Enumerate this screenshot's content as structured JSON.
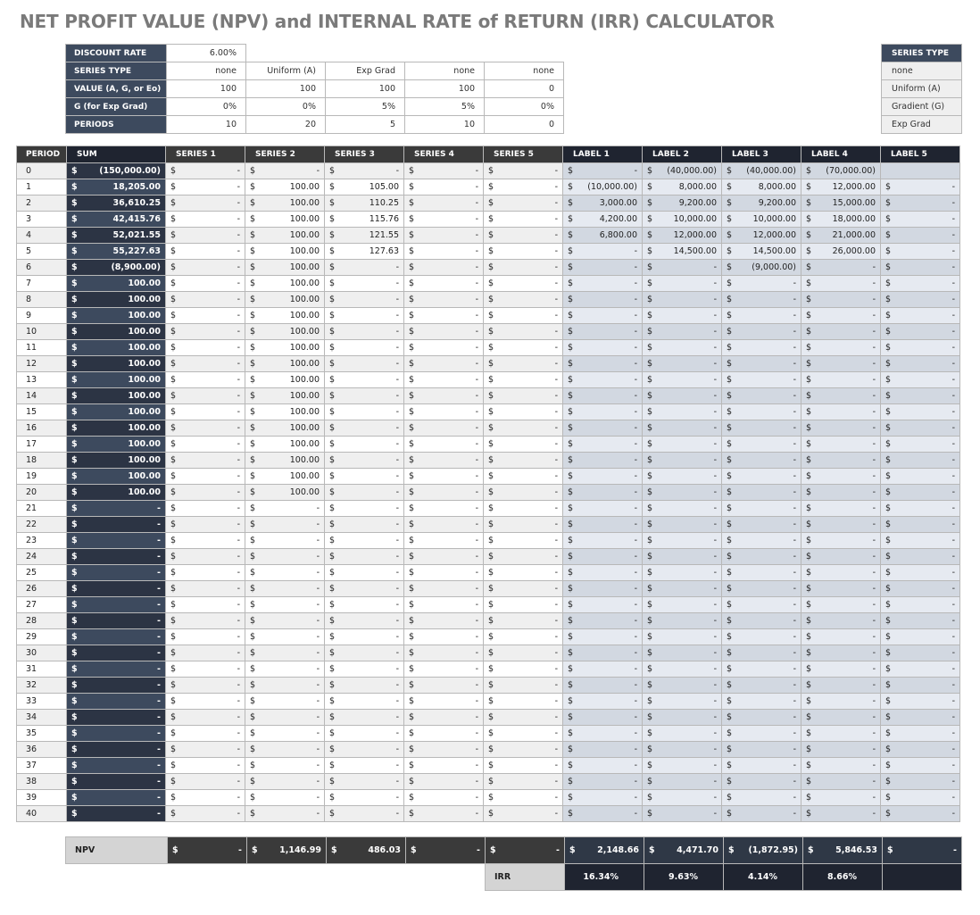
{
  "title": "NET PROFIT VALUE (NPV) and INTERNAL RATE of RETURN (IRR) CALCULATOR",
  "settings": {
    "discount_rate_label": "DISCOUNT RATE",
    "discount_rate": "6.00%",
    "rows": [
      {
        "label": "SERIES TYPE",
        "values": [
          "none",
          "Uniform (A)",
          "Exp Grad",
          "none",
          "none"
        ]
      },
      {
        "label": "VALUE (A, G, or Eo)",
        "values": [
          "100",
          "100",
          "100",
          "100",
          "0"
        ]
      },
      {
        "label": "G (for Exp Grad)",
        "values": [
          "0%",
          "0%",
          "5%",
          "5%",
          "0%"
        ]
      },
      {
        "label": "PERIODS",
        "values": [
          "10",
          "20",
          "5",
          "10",
          "0"
        ]
      }
    ]
  },
  "legend": {
    "header": "SERIES TYPE",
    "items": [
      "none",
      "Uniform (A)",
      "Gradient (G)",
      "Exp Grad"
    ]
  },
  "main": {
    "headers": [
      "PERIOD",
      "SUM",
      "SERIES 1",
      "SERIES 2",
      "SERIES 3",
      "SERIES 4",
      "SERIES 5",
      "LABEL 1",
      "LABEL 2",
      "LABEL 3",
      "LABEL 4",
      "LABEL 5"
    ],
    "currency": "$",
    "rows": [
      {
        "period": "0",
        "sum": "(150,000.00)",
        "series": [
          "-",
          "-",
          "-",
          "-",
          "-"
        ],
        "labels": [
          "-",
          "(40,000.00)",
          "(40,000.00)",
          "(70,000.00)",
          null
        ]
      },
      {
        "period": "1",
        "sum": "18,205.00",
        "series": [
          "-",
          "100.00",
          "105.00",
          "-",
          "-"
        ],
        "labels": [
          "(10,000.00)",
          "8,000.00",
          "8,000.00",
          "12,000.00",
          "-"
        ]
      },
      {
        "period": "2",
        "sum": "36,610.25",
        "series": [
          "-",
          "100.00",
          "110.25",
          "-",
          "-"
        ],
        "labels": [
          "3,000.00",
          "9,200.00",
          "9,200.00",
          "15,000.00",
          "-"
        ]
      },
      {
        "period": "3",
        "sum": "42,415.76",
        "series": [
          "-",
          "100.00",
          "115.76",
          "-",
          "-"
        ],
        "labels": [
          "4,200.00",
          "10,000.00",
          "10,000.00",
          "18,000.00",
          "-"
        ]
      },
      {
        "period": "4",
        "sum": "52,021.55",
        "series": [
          "-",
          "100.00",
          "121.55",
          "-",
          "-"
        ],
        "labels": [
          "6,800.00",
          "12,000.00",
          "12,000.00",
          "21,000.00",
          "-"
        ]
      },
      {
        "period": "5",
        "sum": "55,227.63",
        "series": [
          "-",
          "100.00",
          "127.63",
          "-",
          "-"
        ],
        "labels": [
          "-",
          "14,500.00",
          "14,500.00",
          "26,000.00",
          "-"
        ]
      },
      {
        "period": "6",
        "sum": "(8,900.00)",
        "series": [
          "-",
          "100.00",
          "-",
          "-",
          "-"
        ],
        "labels": [
          "-",
          "-",
          "(9,000.00)",
          "-",
          "-"
        ]
      },
      {
        "period": "7",
        "sum": "100.00",
        "series": [
          "-",
          "100.00",
          "-",
          "-",
          "-"
        ],
        "labels": [
          "-",
          "-",
          "-",
          "-",
          "-"
        ]
      },
      {
        "period": "8",
        "sum": "100.00",
        "series": [
          "-",
          "100.00",
          "-",
          "-",
          "-"
        ],
        "labels": [
          "-",
          "-",
          "-",
          "-",
          "-"
        ]
      },
      {
        "period": "9",
        "sum": "100.00",
        "series": [
          "-",
          "100.00",
          "-",
          "-",
          "-"
        ],
        "labels": [
          "-",
          "-",
          "-",
          "-",
          "-"
        ]
      },
      {
        "period": "10",
        "sum": "100.00",
        "series": [
          "-",
          "100.00",
          "-",
          "-",
          "-"
        ],
        "labels": [
          "-",
          "-",
          "-",
          "-",
          "-"
        ]
      },
      {
        "period": "11",
        "sum": "100.00",
        "series": [
          "-",
          "100.00",
          "-",
          "-",
          "-"
        ],
        "labels": [
          "-",
          "-",
          "-",
          "-",
          "-"
        ]
      },
      {
        "period": "12",
        "sum": "100.00",
        "series": [
          "-",
          "100.00",
          "-",
          "-",
          "-"
        ],
        "labels": [
          "-",
          "-",
          "-",
          "-",
          "-"
        ]
      },
      {
        "period": "13",
        "sum": "100.00",
        "series": [
          "-",
          "100.00",
          "-",
          "-",
          "-"
        ],
        "labels": [
          "-",
          "-",
          "-",
          "-",
          "-"
        ]
      },
      {
        "period": "14",
        "sum": "100.00",
        "series": [
          "-",
          "100.00",
          "-",
          "-",
          "-"
        ],
        "labels": [
          "-",
          "-",
          "-",
          "-",
          "-"
        ]
      },
      {
        "period": "15",
        "sum": "100.00",
        "series": [
          "-",
          "100.00",
          "-",
          "-",
          "-"
        ],
        "labels": [
          "-",
          "-",
          "-",
          "-",
          "-"
        ]
      },
      {
        "period": "16",
        "sum": "100.00",
        "series": [
          "-",
          "100.00",
          "-",
          "-",
          "-"
        ],
        "labels": [
          "-",
          "-",
          "-",
          "-",
          "-"
        ]
      },
      {
        "period": "17",
        "sum": "100.00",
        "series": [
          "-",
          "100.00",
          "-",
          "-",
          "-"
        ],
        "labels": [
          "-",
          "-",
          "-",
          "-",
          "-"
        ]
      },
      {
        "period": "18",
        "sum": "100.00",
        "series": [
          "-",
          "100.00",
          "-",
          "-",
          "-"
        ],
        "labels": [
          "-",
          "-",
          "-",
          "-",
          "-"
        ]
      },
      {
        "period": "19",
        "sum": "100.00",
        "series": [
          "-",
          "100.00",
          "-",
          "-",
          "-"
        ],
        "labels": [
          "-",
          "-",
          "-",
          "-",
          "-"
        ]
      },
      {
        "period": "20",
        "sum": "100.00",
        "series": [
          "-",
          "100.00",
          "-",
          "-",
          "-"
        ],
        "labels": [
          "-",
          "-",
          "-",
          "-",
          "-"
        ]
      },
      {
        "period": "21",
        "sum": "-",
        "series": [
          "-",
          "-",
          "-",
          "-",
          "-"
        ],
        "labels": [
          "-",
          "-",
          "-",
          "-",
          "-"
        ]
      },
      {
        "period": "22",
        "sum": "-",
        "series": [
          "-",
          "-",
          "-",
          "-",
          "-"
        ],
        "labels": [
          "-",
          "-",
          "-",
          "-",
          "-"
        ]
      },
      {
        "period": "23",
        "sum": "-",
        "series": [
          "-",
          "-",
          "-",
          "-",
          "-"
        ],
        "labels": [
          "-",
          "-",
          "-",
          "-",
          "-"
        ]
      },
      {
        "period": "24",
        "sum": "-",
        "series": [
          "-",
          "-",
          "-",
          "-",
          "-"
        ],
        "labels": [
          "-",
          "-",
          "-",
          "-",
          "-"
        ]
      },
      {
        "period": "25",
        "sum": "-",
        "series": [
          "-",
          "-",
          "-",
          "-",
          "-"
        ],
        "labels": [
          "-",
          "-",
          "-",
          "-",
          "-"
        ]
      },
      {
        "period": "26",
        "sum": "-",
        "series": [
          "-",
          "-",
          "-",
          "-",
          "-"
        ],
        "labels": [
          "-",
          "-",
          "-",
          "-",
          "-"
        ]
      },
      {
        "period": "27",
        "sum": "-",
        "series": [
          "-",
          "-",
          "-",
          "-",
          "-"
        ],
        "labels": [
          "-",
          "-",
          "-",
          "-",
          "-"
        ]
      },
      {
        "period": "28",
        "sum": "-",
        "series": [
          "-",
          "-",
          "-",
          "-",
          "-"
        ],
        "labels": [
          "-",
          "-",
          "-",
          "-",
          "-"
        ]
      },
      {
        "period": "29",
        "sum": "-",
        "series": [
          "-",
          "-",
          "-",
          "-",
          "-"
        ],
        "labels": [
          "-",
          "-",
          "-",
          "-",
          "-"
        ]
      },
      {
        "period": "30",
        "sum": "-",
        "series": [
          "-",
          "-",
          "-",
          "-",
          "-"
        ],
        "labels": [
          "-",
          "-",
          "-",
          "-",
          "-"
        ]
      },
      {
        "period": "31",
        "sum": "-",
        "series": [
          "-",
          "-",
          "-",
          "-",
          "-"
        ],
        "labels": [
          "-",
          "-",
          "-",
          "-",
          "-"
        ]
      },
      {
        "period": "32",
        "sum": "-",
        "series": [
          "-",
          "-",
          "-",
          "-",
          "-"
        ],
        "labels": [
          "-",
          "-",
          "-",
          "-",
          "-"
        ]
      },
      {
        "period": "33",
        "sum": "-",
        "series": [
          "-",
          "-",
          "-",
          "-",
          "-"
        ],
        "labels": [
          "-",
          "-",
          "-",
          "-",
          "-"
        ]
      },
      {
        "period": "34",
        "sum": "-",
        "series": [
          "-",
          "-",
          "-",
          "-",
          "-"
        ],
        "labels": [
          "-",
          "-",
          "-",
          "-",
          "-"
        ]
      },
      {
        "period": "35",
        "sum": "-",
        "series": [
          "-",
          "-",
          "-",
          "-",
          "-"
        ],
        "labels": [
          "-",
          "-",
          "-",
          "-",
          "-"
        ]
      },
      {
        "period": "36",
        "sum": "-",
        "series": [
          "-",
          "-",
          "-",
          "-",
          "-"
        ],
        "labels": [
          "-",
          "-",
          "-",
          "-",
          "-"
        ]
      },
      {
        "period": "37",
        "sum": "-",
        "series": [
          "-",
          "-",
          "-",
          "-",
          "-"
        ],
        "labels": [
          "-",
          "-",
          "-",
          "-",
          "-"
        ]
      },
      {
        "period": "38",
        "sum": "-",
        "series": [
          "-",
          "-",
          "-",
          "-",
          "-"
        ],
        "labels": [
          "-",
          "-",
          "-",
          "-",
          "-"
        ]
      },
      {
        "period": "39",
        "sum": "-",
        "series": [
          "-",
          "-",
          "-",
          "-",
          "-"
        ],
        "labels": [
          "-",
          "-",
          "-",
          "-",
          "-"
        ]
      },
      {
        "period": "40",
        "sum": "-",
        "series": [
          "-",
          "-",
          "-",
          "-",
          "-"
        ],
        "labels": [
          "-",
          "-",
          "-",
          "-",
          "-"
        ]
      }
    ]
  },
  "totals": {
    "npv_label": "NPV",
    "npv_series": [
      "-",
      "1,146.99",
      "486.03",
      "-",
      "-"
    ],
    "npv_labels": [
      "2,148.66",
      "4,471.70",
      "(1,872.95)",
      "5,846.53",
      "-"
    ],
    "irr_label": "IRR",
    "irr_values": [
      "16.34%",
      "9.63%",
      "4.14%",
      "8.66%",
      ""
    ]
  },
  "colors": {
    "header_navy": "#3d4a5e",
    "header_dark": "#1f2430",
    "header_charcoal": "#3a3a3a",
    "label_even": "#d2d8e1",
    "label_odd": "#e6eaf1"
  }
}
